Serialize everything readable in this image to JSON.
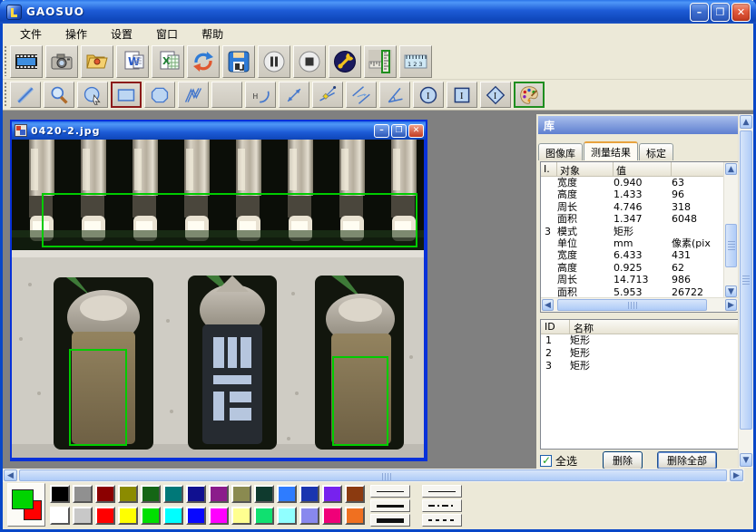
{
  "window": {
    "title": "GAOSUO",
    "controls": {
      "minimize": "–",
      "maximize": "❐",
      "close": "✕"
    }
  },
  "menu": {
    "items": [
      "文件",
      "操作",
      "设置",
      "窗口",
      "帮助"
    ]
  },
  "toolbar_main": {
    "icons": [
      "film",
      "camera",
      "folder-open",
      "word-doc",
      "excel-doc",
      "sync",
      "save",
      "pause",
      "stop",
      "wrench",
      "ruler-select",
      "ruler-calibration"
    ]
  },
  "toolbar_tools": {
    "icons": [
      "line",
      "magnifier",
      "circle-select",
      "rectangle",
      "polygon",
      "polyline",
      "ellipse",
      "arc",
      "distance-arrow",
      "point-line",
      "parallel-lines",
      "angle",
      "circle-label",
      "square-label",
      "diamond-label",
      "palette"
    ],
    "selected_tool": "rectangle",
    "selected_color_tool": "palette"
  },
  "image_window": {
    "title": "0420-2.jpg",
    "controls": {
      "minimize": "–",
      "maximize": "❐",
      "close": "✕"
    }
  },
  "panel": {
    "header": "库",
    "tabs": [
      {
        "label": "图像库",
        "active": false
      },
      {
        "label": "测量结果",
        "active": true
      },
      {
        "label": "标定",
        "active": false
      }
    ],
    "results_table": {
      "columns": [
        "I.",
        "对象",
        "值",
        ""
      ],
      "rows": [
        [
          "",
          "宽度",
          "0.940",
          "63"
        ],
        [
          "",
          "高度",
          "1.433",
          "96"
        ],
        [
          "",
          "周长",
          "4.746",
          "318"
        ],
        [
          "",
          "面积",
          "1.347",
          "6048"
        ],
        [
          "3",
          "模式",
          "矩形",
          ""
        ],
        [
          "",
          "单位",
          "mm",
          "像素(pix"
        ],
        [
          "",
          "宽度",
          "6.433",
          "431"
        ],
        [
          "",
          "高度",
          "0.925",
          "62"
        ],
        [
          "",
          "周长",
          "14.713",
          "986"
        ],
        [
          "",
          "面积",
          "5.953",
          "26722"
        ]
      ]
    },
    "shape_list": {
      "columns": [
        "ID",
        "名称"
      ],
      "rows": [
        [
          "1",
          "矩形"
        ],
        [
          "2",
          "矩形"
        ],
        [
          "3",
          "矩形"
        ]
      ]
    },
    "select_all_label": "全选",
    "delete_label": "删除",
    "delete_all_label": "删除全部"
  },
  "palette": {
    "foreground": "#00D400",
    "background": "#FF0000",
    "row1": [
      "#000000",
      "#909090",
      "#8B0000",
      "#8B8B00",
      "#156615",
      "#007878",
      "#101090",
      "#8B1C8B",
      "#8A8A50",
      "#0F3A2E",
      "#2E7CFF",
      "#1A35B0",
      "#7722EE",
      "#8B3A10"
    ],
    "row2": [
      "#FFFFFF",
      "#C8C8C8",
      "#FF0000",
      "#FFFF00",
      "#00E000",
      "#00FFFF",
      "#0808FF",
      "#FF00FF",
      "#FFFF90",
      "#10E070",
      "#90FFFF",
      "#8888EE",
      "#F00078",
      "#F07020"
    ],
    "line_widths": [
      "thin",
      "medium",
      "thick"
    ],
    "line_styles": [
      "solid",
      "dash-dot",
      "dashed"
    ]
  },
  "colors": {
    "measure_rect": "#00CC00",
    "workspace": "#808080",
    "titlebar_blue": "#1D5BD6"
  }
}
